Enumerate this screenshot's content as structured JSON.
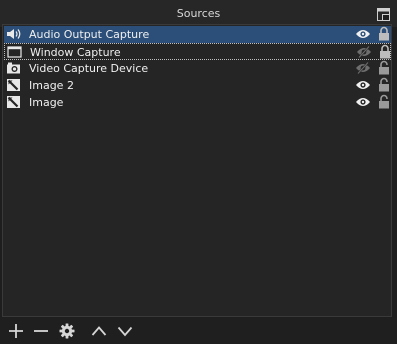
{
  "dock": {
    "title": "Sources"
  },
  "sources": [
    {
      "name": "Audio Output Capture",
      "icon": "speaker-icon",
      "visible": true,
      "locked": true,
      "selected": true
    },
    {
      "name": "Window Capture",
      "icon": "window-icon",
      "visible": false,
      "locked": true,
      "selected": false
    },
    {
      "name": "Video Capture Device",
      "icon": "camera-icon",
      "visible": false,
      "locked": false,
      "selected": false
    },
    {
      "name": "Image 2",
      "icon": "image-icon",
      "visible": true,
      "locked": false,
      "selected": false
    },
    {
      "name": "Image",
      "icon": "image-icon",
      "visible": true,
      "locked": false,
      "selected": false
    }
  ],
  "toolbar": {
    "buttons": [
      "add-icon",
      "remove-icon",
      "gear-icon",
      "chevron-up-icon",
      "chevron-down-icon"
    ]
  },
  "colors": {
    "selection": "#2b4f79",
    "panel": "#252525",
    "background": "#1e1e1e"
  }
}
